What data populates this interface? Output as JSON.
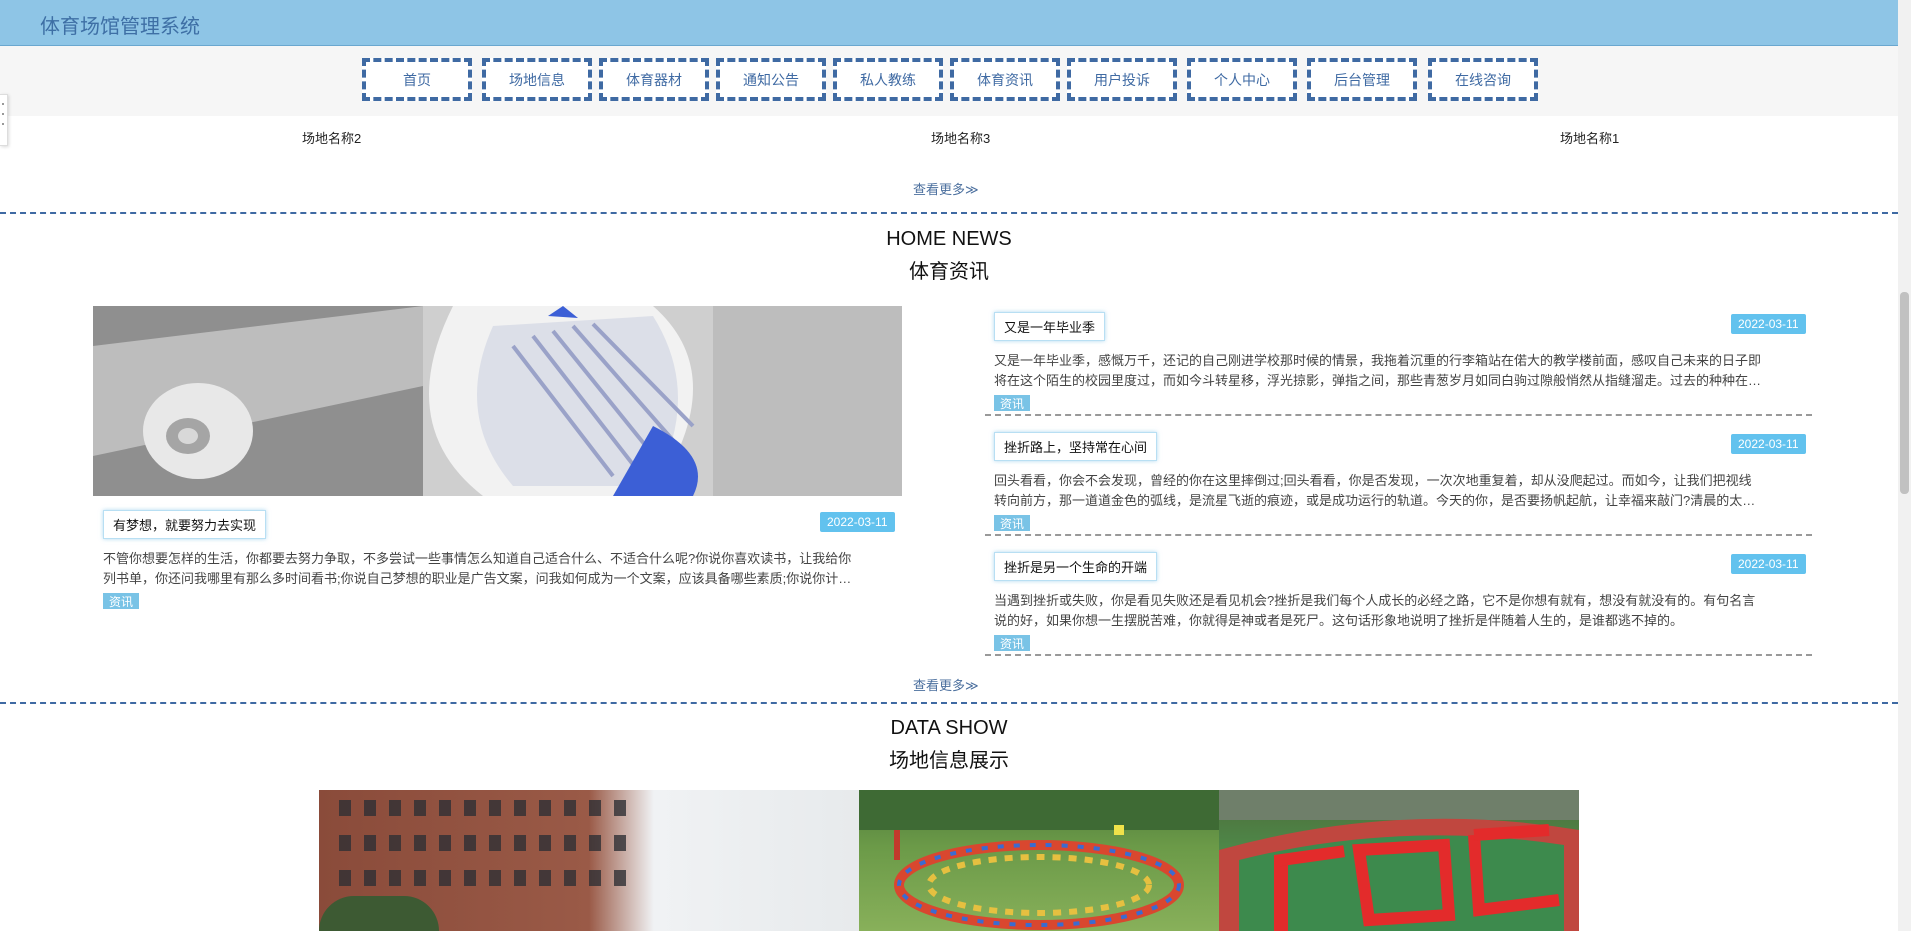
{
  "header": {
    "title": "体育场馆管理系统"
  },
  "nav": {
    "items": [
      "首页",
      "场地信息",
      "体育器材",
      "通知公告",
      "私人教练",
      "体育资讯",
      "用户投诉",
      "个人中心",
      "后台管理",
      "在线咨询"
    ]
  },
  "venues": {
    "names": [
      "场地名称2",
      "场地名称3",
      "场地名称1"
    ],
    "more": "查看更多≫"
  },
  "news_section": {
    "en_title": "HOME NEWS",
    "cn_title": "体育资讯",
    "more": "查看更多≫",
    "featured": {
      "title": "有梦想，就要努力去实现",
      "date": "2022-03-11",
      "desc_line1": "不管你想要怎样的生活，你都要去努力争取，不多尝试一些事情怎么知道自己适合什么、不适合什么呢?你说你喜欢读书，让我给你",
      "desc_line2": "列书单，你还问我哪里有那么多时间看书;你说自己梦想的职业是广告文案，问我如何成为一个文案，应该具备哪些素质;你说你计…",
      "tag": "资讯"
    },
    "list": [
      {
        "title": "又是一年毕业季",
        "date": "2022-03-11",
        "desc_line1": "又是一年毕业季，感慨万千，还记的自己刚进学校那时候的情景，我拖着沉重的行李箱站在偌大的教学楼前面，感叹自己未来的日子即",
        "desc_line2": "将在这个陌生的校园里度过，而如今斗转星移，浮光掠影，弹指之间，那些青葱岁月如同白驹过隙般悄然从指缝溜走。过去的种种在…",
        "tag": "资讯"
      },
      {
        "title": "挫折路上，坚持常在心间",
        "date": "2022-03-11",
        "desc_line1": "回头看看，你会不会发现，曾经的你在这里摔倒过;回头看看，你是否发现，一次次地重复着，却从没爬起过。而如今，让我们把视线",
        "desc_line2": "转向前方，那一道道金色的弧线，是流星飞逝的痕迹，或是成功运行的轨道。今天的你，是否要扬帆起航，让幸福来敲门?清晨的太…",
        "tag": "资讯"
      },
      {
        "title": "挫折是另一个生命的开端",
        "date": "2022-03-11",
        "desc_line1": "当遇到挫折或失败，你是看见失败还是看见机会?挫折是我们每个人成长的必经之路，它不是你想有就有，想没有就没有的。有句名言",
        "desc_line2": "说的好，如果你想一生摆脱苦难，你就得是神或者是死尸。这句话形象地说明了挫折是伴随着人生的，是谁都逃不掉的。",
        "tag": "资讯"
      }
    ]
  },
  "data_show": {
    "en_title": "DATA SHOW",
    "cn_title": "场地信息展示"
  }
}
